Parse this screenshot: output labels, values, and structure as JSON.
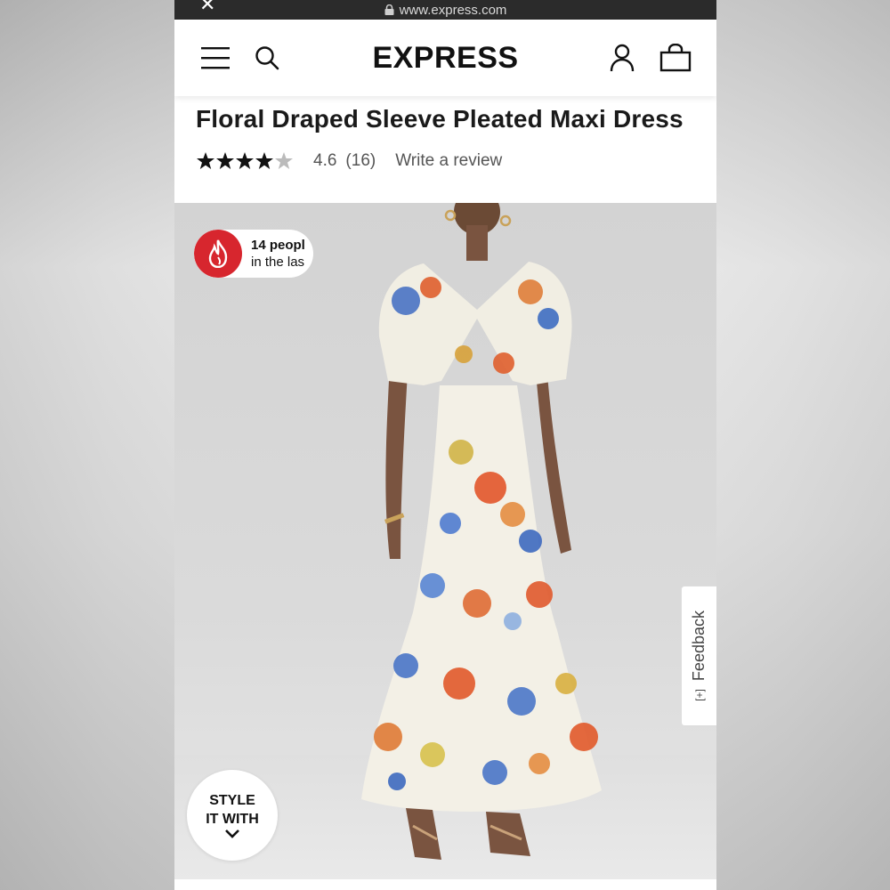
{
  "browser": {
    "url": "www.express.com"
  },
  "header": {
    "brand": "EXPRESS"
  },
  "product": {
    "title": "Floral Draped Sleeve Pleated Maxi Dress",
    "rating": "4.6",
    "review_count": "(16)",
    "rating_stars": 4.6,
    "write_review": "Write a review"
  },
  "badge": {
    "line1": "14 peopl",
    "line2": "in the las"
  },
  "feedback": {
    "label": "Feedback"
  },
  "style_it": {
    "line1": "STYLE",
    "line2": "IT WITH"
  },
  "colors": {
    "badge_red": "#d7262e",
    "url_bar": "#2b2b2b"
  }
}
